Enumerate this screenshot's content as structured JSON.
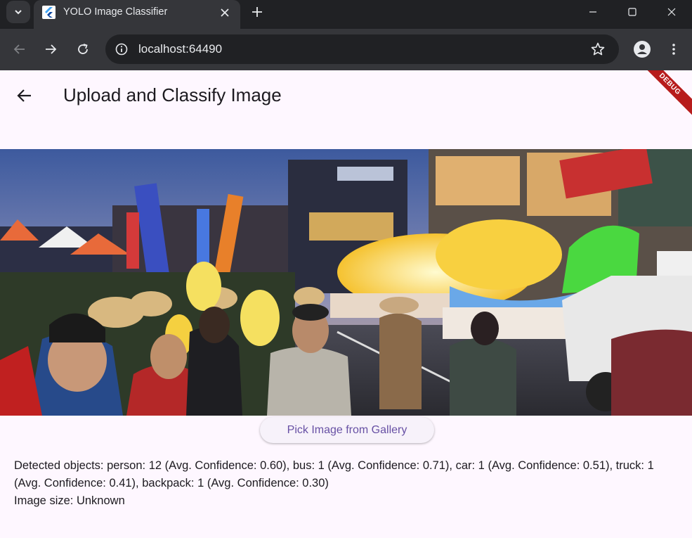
{
  "browser": {
    "tab_title": "YOLO Image Classifier",
    "url": "localhost:64490",
    "icons": {
      "tab_search": "chevron-down-icon",
      "favicon": "flutter-icon",
      "tab_close": "close-icon",
      "new_tab": "plus-icon",
      "minimize": "minimize-icon",
      "maximize": "maximize-icon",
      "close_window": "close-icon",
      "back": "arrow-left-icon",
      "forward": "arrow-right-icon",
      "reload": "reload-icon",
      "site_info": "info-icon",
      "bookmark": "star-icon",
      "profile": "profile-icon",
      "menu": "kebab-menu-icon"
    },
    "colors": {
      "tabstrip": "#202124",
      "toolbar": "#35363a",
      "text": "#e8eaed"
    }
  },
  "app": {
    "title": "Upload and Classify Image",
    "debug_label": "DEBUG",
    "back_icon": "arrow-left-icon",
    "image_alt": "street festival parade photo",
    "pick_button_label": "Pick Image from Gallery",
    "result_line1": "Detected objects: person: 12 (Avg. Confidence: 0.60), bus: 1 (Avg. Confidence: 0.71), car: 1 (Avg. Confidence: 0.51), truck: 1 (Avg. Confidence: 0.41), backpack: 1 (Avg. Confidence: 0.30)",
    "result_line2": "Image size: Unknown",
    "colors": {
      "background": "#fef7ff",
      "accent": "#6750a4",
      "debug": "#b71c1c"
    }
  }
}
